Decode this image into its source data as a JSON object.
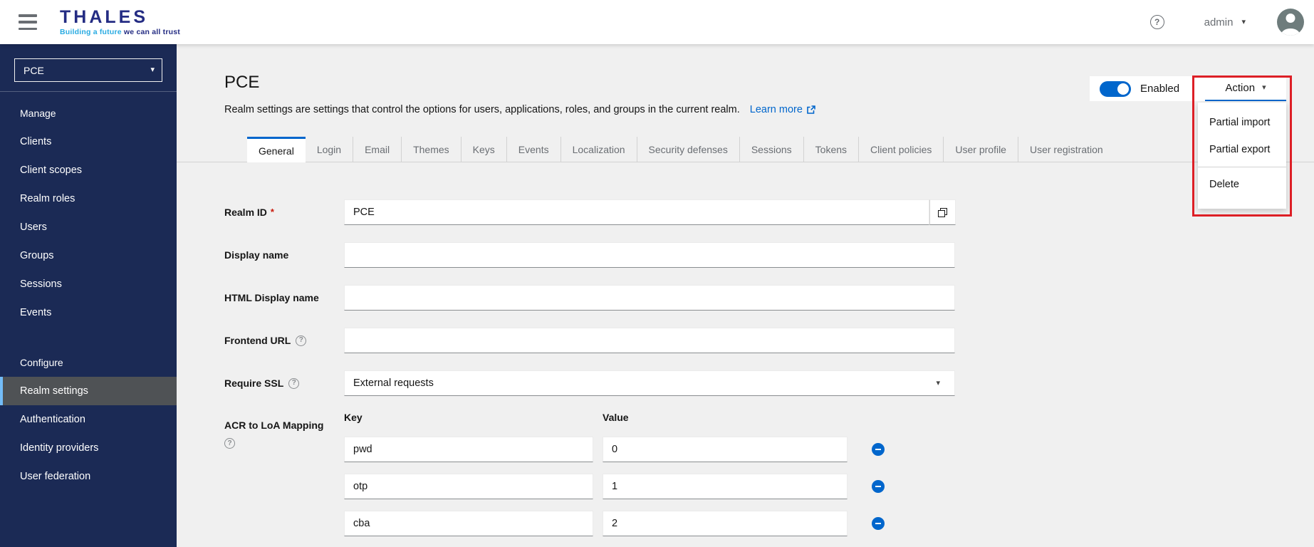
{
  "topbar": {
    "logo": {
      "text": "THALES",
      "tagline_highlight": "Building a future",
      "tagline_rest": " we can all trust"
    },
    "user": "admin"
  },
  "sidebar": {
    "realm_selector": "PCE",
    "active_item": "Realm settings",
    "sections": [
      {
        "label": "Manage",
        "items": [
          "Clients",
          "Client scopes",
          "Realm roles",
          "Users",
          "Groups",
          "Sessions",
          "Events"
        ]
      },
      {
        "label": "Configure",
        "items": [
          "Realm settings",
          "Authentication",
          "Identity providers",
          "User federation"
        ]
      }
    ]
  },
  "header": {
    "title": "PCE",
    "description": "Realm settings are settings that control the options for users, applications, roles, and groups in the current realm.",
    "learn_more": "Learn more",
    "enabled_label": "Enabled",
    "action_label": "Action",
    "action_menu": [
      "Partial import",
      "Partial export",
      "Delete"
    ]
  },
  "tabs": {
    "active": "General",
    "items": [
      "General",
      "Login",
      "Email",
      "Themes",
      "Keys",
      "Events",
      "Localization",
      "Security defenses",
      "Sessions",
      "Tokens",
      "Client policies",
      "User profile",
      "User registration"
    ]
  },
  "form": {
    "realm_id": {
      "label": "Realm ID",
      "required_marker": "*",
      "value": "PCE"
    },
    "display_name": {
      "label": "Display name",
      "value": ""
    },
    "html_display_name": {
      "label": "HTML Display name",
      "value": ""
    },
    "frontend_url": {
      "label": "Frontend URL",
      "value": ""
    },
    "require_ssl": {
      "label": "Require SSL",
      "value": "External requests"
    },
    "acr_mapping": {
      "label": "ACR to LoA Mapping",
      "key_header": "Key",
      "value_header": "Value",
      "rows": [
        {
          "key": "pwd",
          "value": "0"
        },
        {
          "key": "otp",
          "value": "1"
        },
        {
          "key": "cba",
          "value": "2"
        }
      ]
    }
  },
  "icons": {
    "help_glyph": "?",
    "chevron_down": "▾"
  },
  "colors": {
    "accent_blue": "#0066cc",
    "sidebar_navy": "#1b2a55",
    "annotation_red": "#dd1f26",
    "thales_navy": "#242c83",
    "thales_cyan": "#29abe2",
    "page_bg": "#f0f0f0"
  }
}
